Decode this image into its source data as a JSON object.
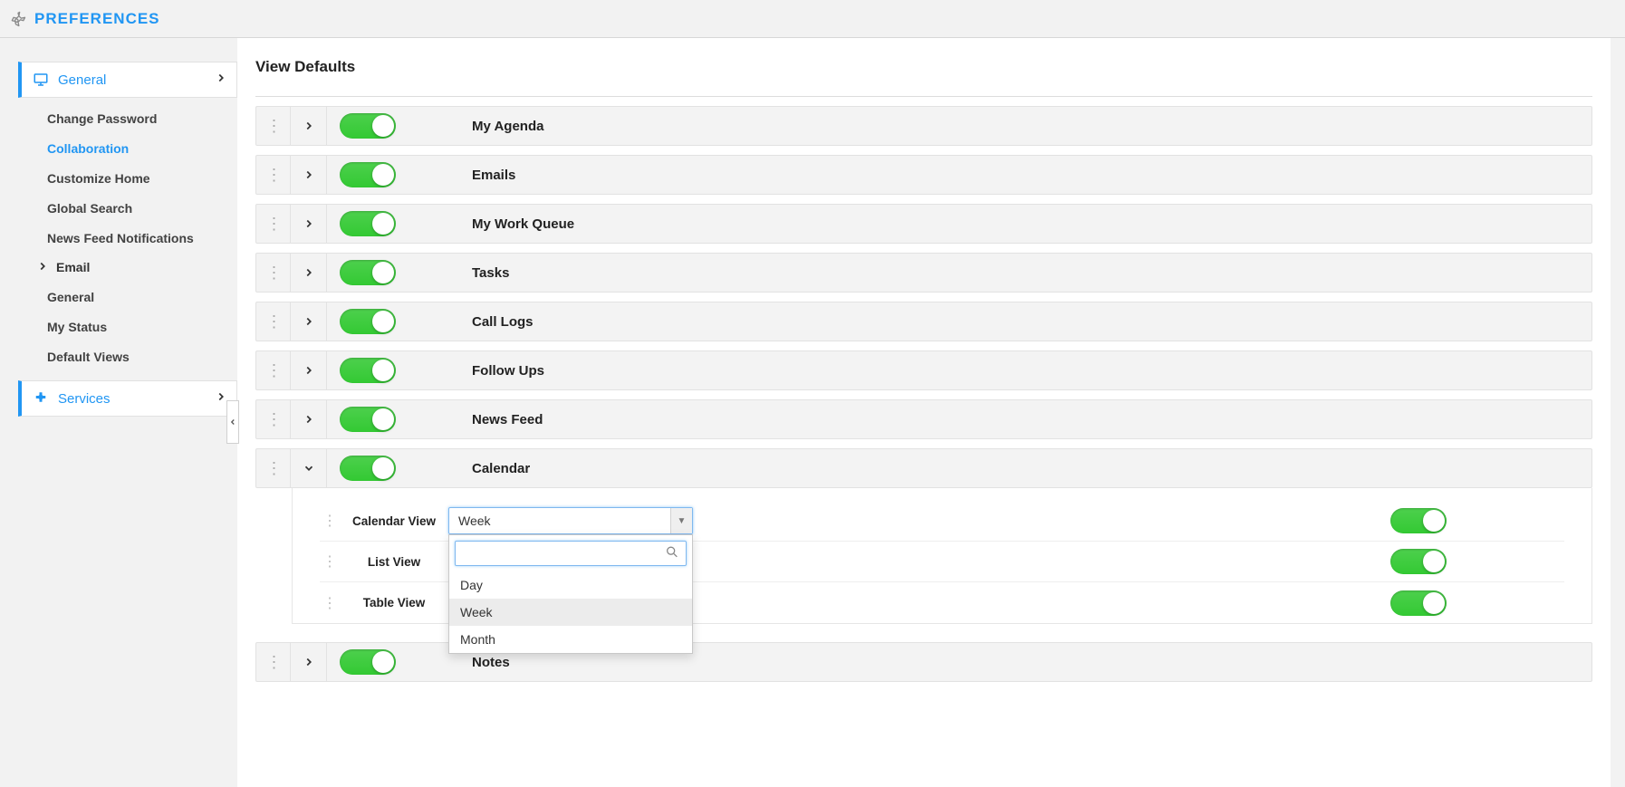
{
  "header": {
    "title": "PREFERENCES"
  },
  "sidebar": {
    "groups": [
      {
        "label": "General"
      },
      {
        "label": "Services"
      }
    ],
    "general_items": [
      {
        "label": "Change Password"
      },
      {
        "label": "Collaboration"
      },
      {
        "label": "Customize Home"
      },
      {
        "label": "Global Search"
      },
      {
        "label": "News Feed Notifications"
      }
    ],
    "email_header": "Email",
    "email_items": [
      {
        "label": "General"
      },
      {
        "label": "My Status"
      },
      {
        "label": "Default Views"
      }
    ]
  },
  "main": {
    "title": "View Defaults",
    "rows": [
      {
        "label": "My Agenda"
      },
      {
        "label": "Emails"
      },
      {
        "label": "My Work Queue"
      },
      {
        "label": "Tasks"
      },
      {
        "label": "Call Logs"
      },
      {
        "label": "Follow Ups"
      },
      {
        "label": "News Feed"
      },
      {
        "label": "Calendar"
      },
      {
        "label": "Notes"
      }
    ],
    "calendar_sub": {
      "rows": [
        {
          "label": "Calendar View",
          "value": "Week"
        },
        {
          "label": "List View"
        },
        {
          "label": "Table View"
        }
      ],
      "dropdown": {
        "search_value": "",
        "options": [
          "Day",
          "Week",
          "Month"
        ],
        "highlight": "Week"
      }
    }
  }
}
